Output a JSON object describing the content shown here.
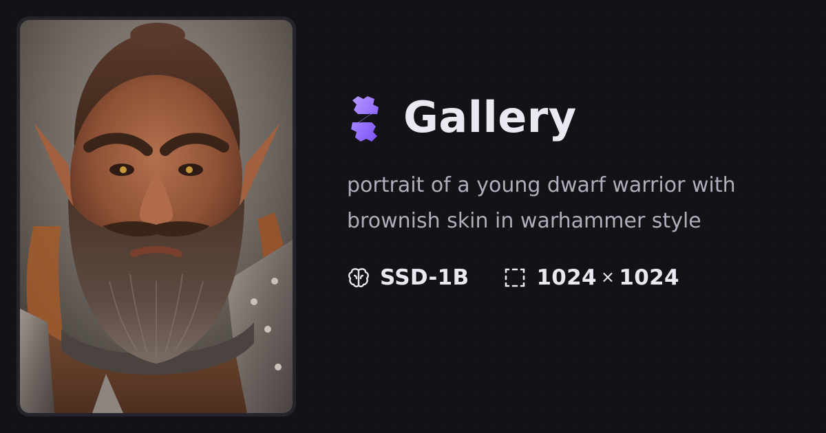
{
  "card": {
    "title": "Gallery",
    "prompt": "portrait of a young dwarf warrior with brownish skin in warhammer style",
    "model": {
      "icon": "brain-icon",
      "label": "SSD-1B"
    },
    "dimensions": {
      "icon": "dashed-frame-icon",
      "width": "1024",
      "separator": "×",
      "height": "1024"
    },
    "image": {
      "subject": "painted portrait of a dwarf warrior with a bun, pointed ears, thick beard and plate armor"
    }
  },
  "colors": {
    "background": "#131217",
    "title": "#ebe8f2",
    "prompt": "#b1adbb",
    "accent_start": "#a788ff",
    "accent_end": "#7c4dff"
  }
}
